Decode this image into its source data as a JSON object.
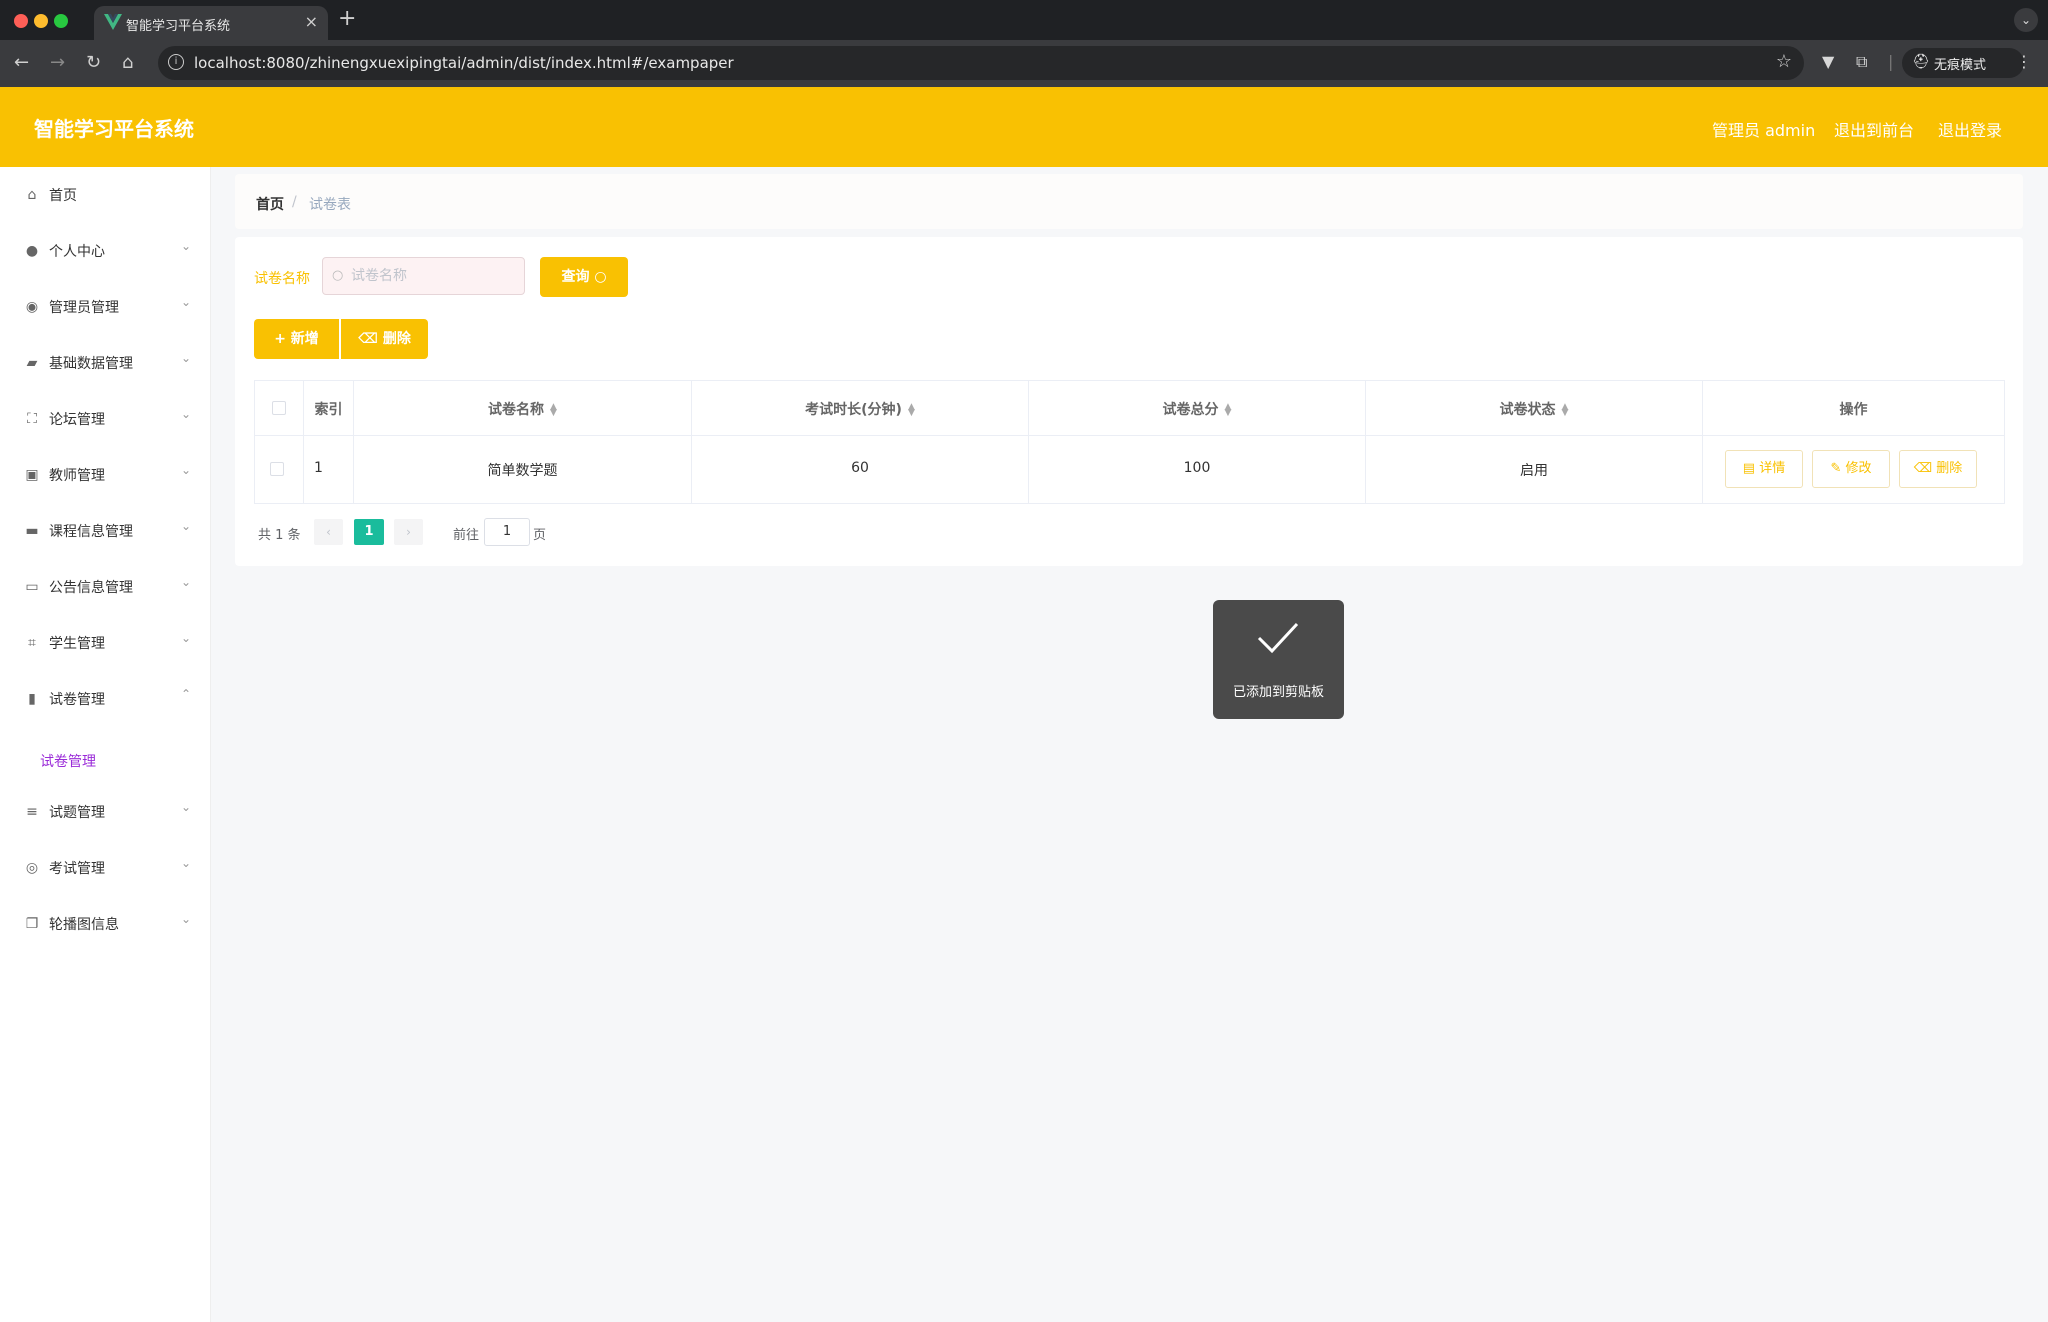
{
  "browser": {
    "tab_title": "智能学习平台系统",
    "url": "localhost:8080/zhinengxuexipingtai/admin/dist/index.html#/exampaper",
    "incognito_label": "无痕模式"
  },
  "header": {
    "title": "智能学习平台系统",
    "admin_label": "管理员 admin",
    "back_label": "退出到前台",
    "logout_label": "退出登录"
  },
  "sidebar": {
    "items": [
      {
        "label": "首页",
        "icon": "home-icon"
      },
      {
        "label": "个人中心",
        "icon": "user-icon"
      },
      {
        "label": "管理员管理",
        "icon": "pin-icon"
      },
      {
        "label": "基础数据管理",
        "icon": "ticket-icon"
      },
      {
        "label": "论坛管理",
        "icon": "frame-icon"
      },
      {
        "label": "教师管理",
        "icon": "clipboard-icon"
      },
      {
        "label": "课程信息管理",
        "icon": "presentation-icon"
      },
      {
        "label": "公告信息管理",
        "icon": "card-icon"
      },
      {
        "label": "学生管理",
        "icon": "crop-icon"
      },
      {
        "label": "试卷管理",
        "icon": "chart-icon"
      },
      {
        "label": "试题管理",
        "icon": "list-icon"
      },
      {
        "label": "考试管理",
        "icon": "compass-icon"
      },
      {
        "label": "轮播图信息",
        "icon": "copy-icon"
      }
    ],
    "sub_item": "试卷管理"
  },
  "breadcrumb": {
    "home": "首页",
    "separator": "/",
    "current": "试卷表"
  },
  "search": {
    "label": "试卷名称",
    "placeholder": "试卷名称",
    "query_label": "查询"
  },
  "actions": {
    "add_label": "新增",
    "delete_label": "删除"
  },
  "table": {
    "headers": [
      "索引",
      "试卷名称",
      "考试时长(分钟)",
      "试卷总分",
      "试卷状态",
      "操作"
    ],
    "rows": [
      {
        "index": "1",
        "name": "简单数学题",
        "duration": "60",
        "score": "100",
        "status": "启用"
      }
    ],
    "op_labels": {
      "detail": "详情",
      "edit": "修改",
      "delete": "删除"
    }
  },
  "pagination": {
    "total": "共 1 条",
    "current": "1",
    "goto": "前往",
    "goto_value": "1",
    "page": "页"
  },
  "toast": {
    "text": "已添加到剪贴板"
  },
  "colors": {
    "accent": "#f9c102",
    "active_page": "#1abc9c",
    "submenu_active": "#9a2bd8"
  }
}
